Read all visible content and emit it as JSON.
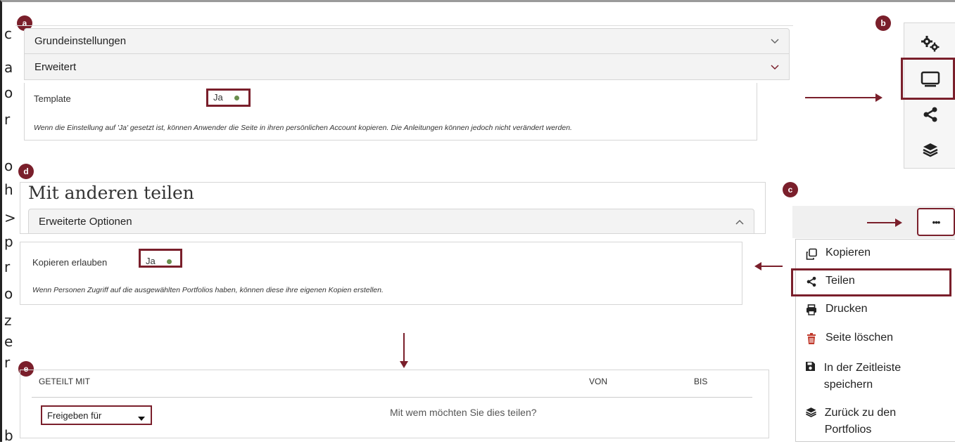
{
  "badges": {
    "a": "a",
    "b": "b",
    "c": "c",
    "d": "d",
    "e": "e"
  },
  "left_chars": [
    "c",
    "a",
    "o",
    "r",
    "o",
    "h",
    ">",
    "p",
    "r",
    "o",
    "z",
    "e",
    "r",
    "b"
  ],
  "section_a": {
    "panel1": "Grundeinstellungen",
    "panel2": "Erweitert",
    "setting_label": "Template",
    "toggle_value": "Ja",
    "hint": "Wenn die Einstellung auf 'Ja' gesetzt ist, können Anwender die Seite in ihren persönlichen Account kopieren. Die Anleitungen können jedoch nicht verändert werden."
  },
  "section_d": {
    "title": "Mit anderen teilen",
    "panel": "Erweiterte Optionen",
    "setting_label": "Kopieren erlauben",
    "toggle_value": "Ja",
    "hint": "Wenn Personen Zugriff auf die ausgewählten Portfolios haben, können diese ihre eigenen Kopien erstellen."
  },
  "section_e": {
    "col_shared": "GETEILT MIT",
    "col_from": "VON",
    "col_to": "BIS",
    "select_value": "Freigeben für",
    "prompt": "Mit wem möchten Sie dies teilen?"
  },
  "section_b": {
    "icons": [
      "settings-gears-icon",
      "display-icon",
      "share-icon",
      "layers-icon"
    ]
  },
  "section_c": {
    "more_button": "•••",
    "menu": [
      {
        "label": "Kopieren",
        "icon": "copy-icon"
      },
      {
        "label": "Teilen",
        "icon": "share-icon"
      },
      {
        "label": "Drucken",
        "icon": "print-icon"
      },
      {
        "label": "Seite löschen",
        "icon": "trash-icon"
      },
      {
        "label": "In der Zeitleiste speichern",
        "icon": "save-icon"
      },
      {
        "label": "Zurück zu den Portfolios",
        "icon": "layers-icon"
      }
    ]
  },
  "colors": {
    "accent": "#7a1f2b",
    "toggle_dot": "#6a8f4e",
    "trash": "#c0392b"
  }
}
